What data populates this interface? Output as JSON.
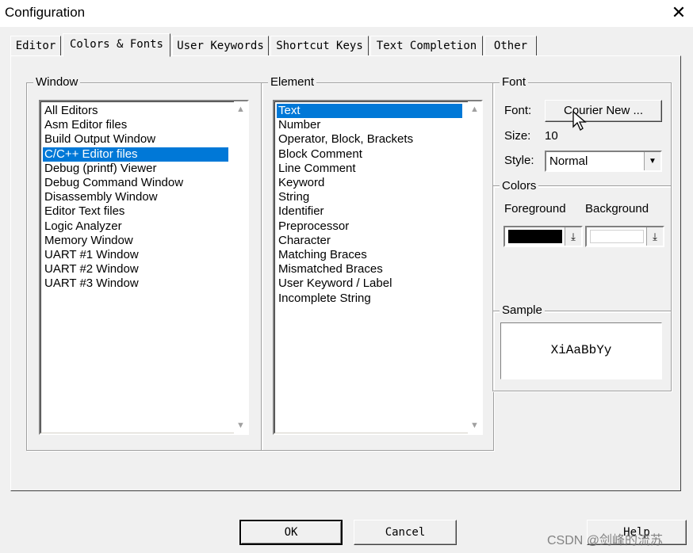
{
  "window": {
    "title": "Configuration",
    "close_label": "✕"
  },
  "tabs": [
    {
      "label": "Editor"
    },
    {
      "label": "Colors & Fonts",
      "active": true
    },
    {
      "label": "User Keywords"
    },
    {
      "label": "Shortcut Keys"
    },
    {
      "label": "Text Completion"
    },
    {
      "label": "Other"
    }
  ],
  "window_group": {
    "legend": "Window",
    "selected": "C/C++ Editor files",
    "items": [
      "All Editors",
      "Asm Editor files",
      "Build Output Window",
      "C/C++ Editor files",
      "Debug (printf) Viewer",
      "Debug Command Window",
      "Disassembly Window",
      "Editor Text files",
      "Logic Analyzer",
      "Memory Window",
      "UART #1 Window",
      "UART #2 Window",
      "UART #3 Window"
    ]
  },
  "element_group": {
    "legend": "Element",
    "selected": "Text",
    "items": [
      "Text",
      "Number",
      "Operator, Block, Brackets",
      "Block Comment",
      "Line Comment",
      "Keyword",
      "String",
      "Identifier",
      "Preprocessor",
      "Character",
      "Matching Braces",
      "Mismatched Braces",
      "User Keyword / Label",
      "Incomplete String"
    ]
  },
  "font_group": {
    "legend": "Font",
    "font_label": "Font:",
    "font_button": "Courier New ...",
    "size_label": "Size:",
    "size_value": "10",
    "style_label": "Style:",
    "style_value": "Normal"
  },
  "colors_group": {
    "legend": "Colors",
    "foreground_label": "Foreground",
    "background_label": "Background",
    "foreground_color": "#000000",
    "background_color": "#ffffff"
  },
  "sample_group": {
    "legend": "Sample",
    "sample_text": "XiAaBbYy"
  },
  "buttons": {
    "ok": "OK",
    "cancel": "Cancel",
    "help": "Help"
  },
  "watermark": "CSDN @剑峰的流苏",
  "colors": {
    "selection": "#0078d7"
  }
}
